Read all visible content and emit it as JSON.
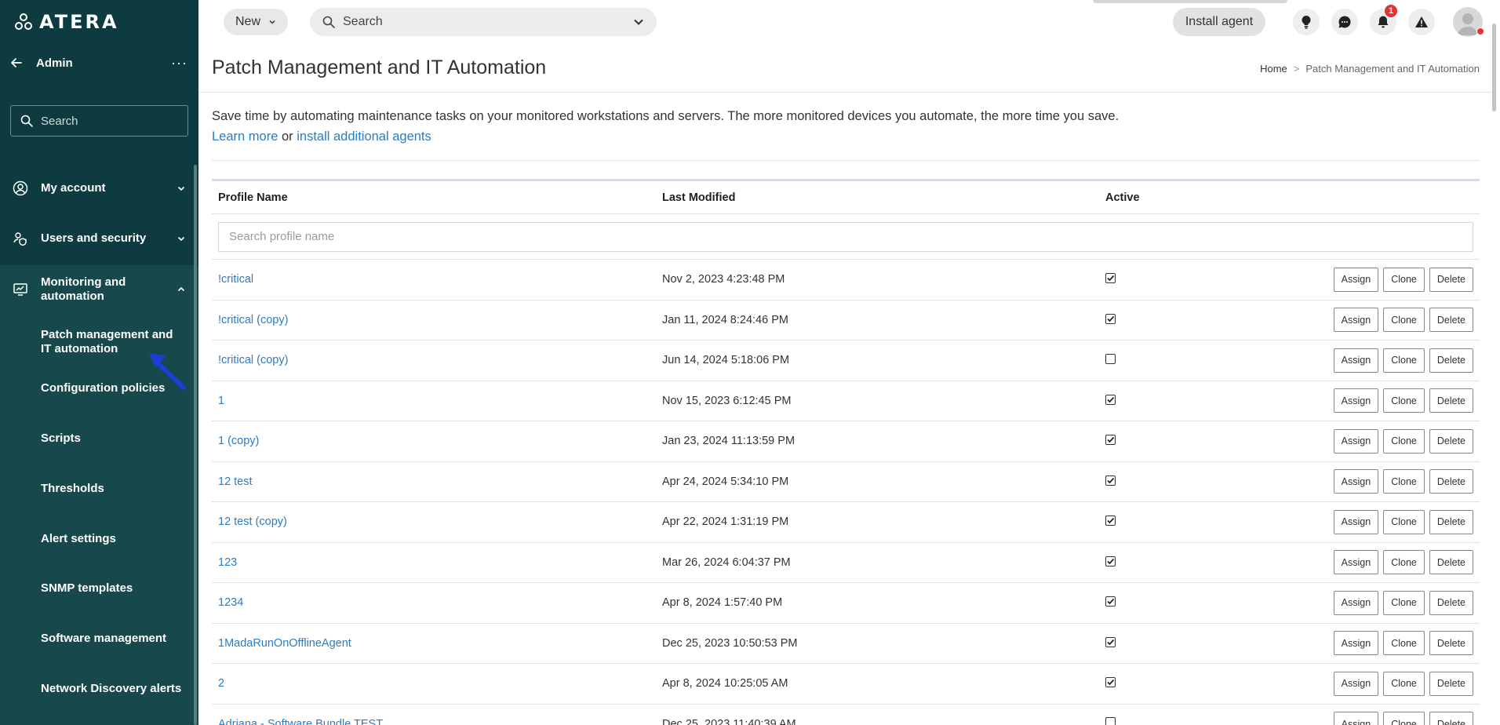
{
  "sidebar": {
    "logo_text": "ATERA",
    "admin_title": "Admin",
    "more_label": "···",
    "search_placeholder": "Search",
    "sections": [
      {
        "label": "My account"
      },
      {
        "label": "Users and security"
      },
      {
        "label": "Monitoring and automation"
      }
    ],
    "sub_items": [
      {
        "label": "Patch management and IT automation"
      },
      {
        "label": "Configuration policies"
      },
      {
        "label": "Scripts"
      },
      {
        "label": "Thresholds"
      },
      {
        "label": "Alert settings"
      },
      {
        "label": "SNMP templates"
      },
      {
        "label": "Software management"
      },
      {
        "label": "Network Discovery alerts"
      }
    ]
  },
  "topbar": {
    "new_label": "New",
    "search_placeholder": "Search",
    "install_label": "Install agent",
    "notification_count": "1"
  },
  "page": {
    "title": "Patch Management and IT Automation",
    "breadcrumb_home": "Home",
    "breadcrumb_sep": ">",
    "breadcrumb_current": "Patch Management and IT Automation",
    "intro_text": "Save time by automating maintenance tasks on your monitored workstations and servers. The more monitored devices you automate, the more time you save.",
    "learn_more": "Learn more",
    "or_text": " or ",
    "install_more": "install additional agents"
  },
  "table": {
    "headers": {
      "name": "Profile Name",
      "modified": "Last Modified",
      "active": "Active"
    },
    "filter_placeholder": "Search profile name",
    "actions": {
      "assign": "Assign",
      "clone": "Clone",
      "delete": "Delete"
    },
    "rows": [
      {
        "name": "!critical",
        "modified": "Nov 2, 2023 4:23:48 PM",
        "active": true
      },
      {
        "name": "!critical (copy)",
        "modified": "Jan 11, 2024 8:24:46 PM",
        "active": true
      },
      {
        "name": "!critical (copy)",
        "modified": "Jun 14, 2024 5:18:06 PM",
        "active": false
      },
      {
        "name": "1",
        "modified": "Nov 15, 2023 6:12:45 PM",
        "active": true
      },
      {
        "name": "1 (copy)",
        "modified": "Jan 23, 2024 11:13:59 PM",
        "active": true
      },
      {
        "name": "12 test",
        "modified": "Apr 24, 2024 5:34:10 PM",
        "active": true
      },
      {
        "name": "12 test (copy)",
        "modified": "Apr 22, 2024 1:31:19 PM",
        "active": true
      },
      {
        "name": "123",
        "modified": "Mar 26, 2024 6:04:37 PM",
        "active": true
      },
      {
        "name": "1234",
        "modified": "Apr 8, 2024 1:57:40 PM",
        "active": true
      },
      {
        "name": "1MadaRunOnOfflineAgent",
        "modified": "Dec 25, 2023 10:50:53 PM",
        "active": true
      },
      {
        "name": "2",
        "modified": "Apr 8, 2024 10:25:05 AM",
        "active": true
      },
      {
        "name": "Adriana - Software Bundle TEST",
        "modified": "Dec 25, 2023 11:40:39 AM",
        "active": false
      }
    ]
  }
}
